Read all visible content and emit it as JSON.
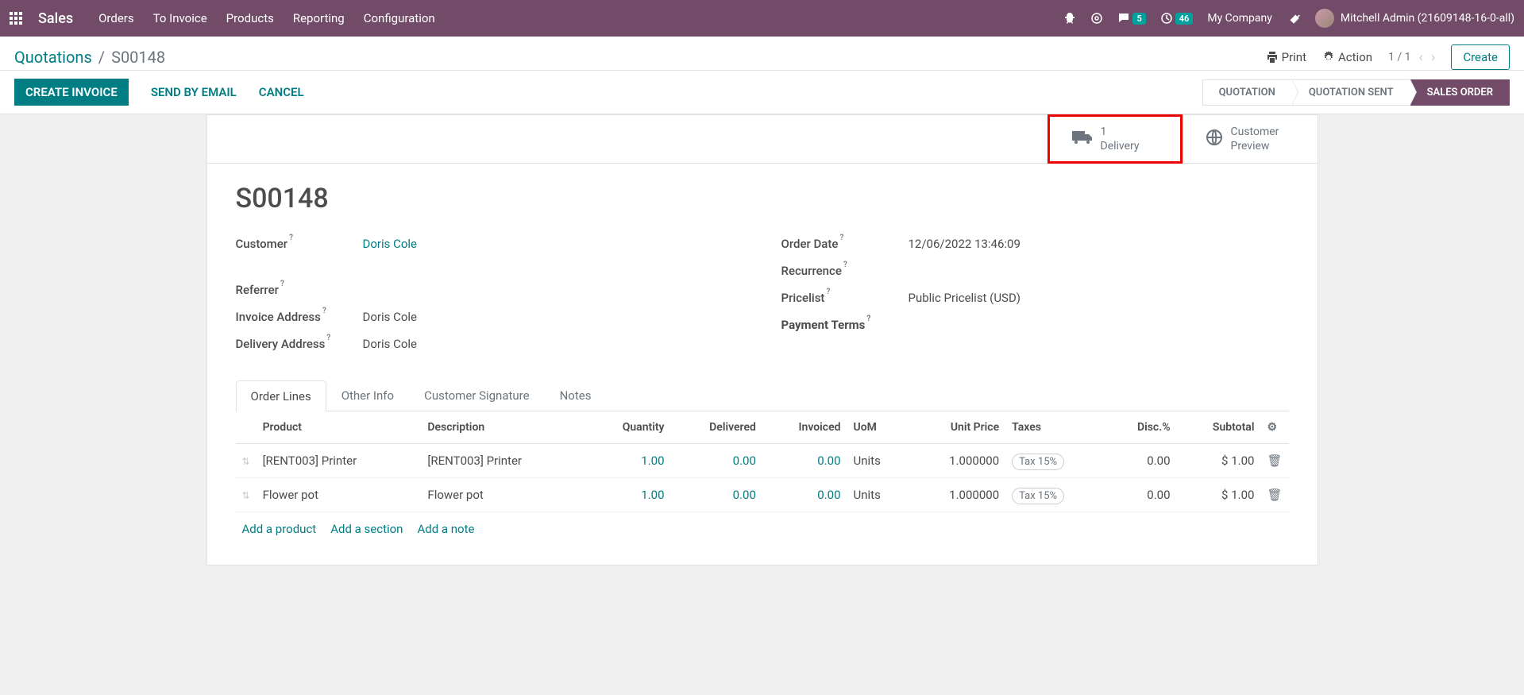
{
  "navbar": {
    "brand": "Sales",
    "links": [
      "Orders",
      "To Invoice",
      "Products",
      "Reporting",
      "Configuration"
    ],
    "chat_badge": "5",
    "activity_badge": "46",
    "company": "My Company",
    "user_name": "Mitchell Admin (21609148-16-0-all)"
  },
  "breadcrumb": {
    "root": "Quotations",
    "current": "S00148"
  },
  "controlbar": {
    "print": "Print",
    "action": "Action",
    "pager": "1 / 1",
    "create": "Create"
  },
  "statusbar": {
    "create_invoice": "CREATE INVOICE",
    "send_email": "SEND BY EMAIL",
    "cancel": "CANCEL",
    "states": [
      "QUOTATION",
      "QUOTATION SENT",
      "SALES ORDER"
    ]
  },
  "smart_buttons": {
    "delivery_count": "1",
    "delivery_label": "Delivery",
    "preview_l1": "Customer",
    "preview_l2": "Preview"
  },
  "form": {
    "title": "S00148",
    "customer_label": "Customer",
    "customer_value": "Doris Cole",
    "referrer_label": "Referrer",
    "referrer_value": "",
    "invoice_addr_label": "Invoice Address",
    "invoice_addr_value": "Doris Cole",
    "delivery_addr_label": "Delivery Address",
    "delivery_addr_value": "Doris Cole",
    "order_date_label": "Order Date",
    "order_date_value": "12/06/2022 13:46:09",
    "recurrence_label": "Recurrence",
    "recurrence_value": "",
    "pricelist_label": "Pricelist",
    "pricelist_value": "Public Pricelist (USD)",
    "payment_terms_label": "Payment Terms",
    "payment_terms_value": ""
  },
  "tabs": [
    "Order Lines",
    "Other Info",
    "Customer Signature",
    "Notes"
  ],
  "lines": {
    "headers": {
      "product": "Product",
      "description": "Description",
      "quantity": "Quantity",
      "delivered": "Delivered",
      "invoiced": "Invoiced",
      "uom": "UoM",
      "unit_price": "Unit Price",
      "taxes": "Taxes",
      "disc": "Disc.%",
      "subtotal": "Subtotal"
    },
    "rows": [
      {
        "product": "[RENT003] Printer",
        "description": "[RENT003] Printer",
        "quantity": "1.00",
        "delivered": "0.00",
        "invoiced": "0.00",
        "uom": "Units",
        "unit_price": "1.000000",
        "taxes": "Tax 15%",
        "disc": "0.00",
        "subtotal": "$ 1.00"
      },
      {
        "product": "Flower pot",
        "description": "Flower pot",
        "quantity": "1.00",
        "delivered": "0.00",
        "invoiced": "0.00",
        "uom": "Units",
        "unit_price": "1.000000",
        "taxes": "Tax 15%",
        "disc": "0.00",
        "subtotal": "$ 1.00"
      }
    ],
    "add_product": "Add a product",
    "add_section": "Add a section",
    "add_note": "Add a note"
  }
}
